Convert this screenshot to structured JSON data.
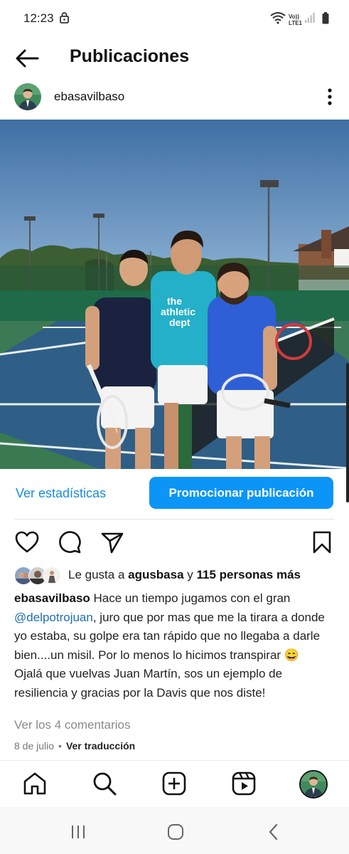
{
  "status_bar": {
    "time": "12:23",
    "icons": [
      "lock-icon",
      "wifi-icon",
      "volte-icon",
      "signal-icon",
      "battery-icon"
    ],
    "network_label_top": "Vo))",
    "network_label_bottom": "LTE1"
  },
  "header": {
    "title": "Publicaciones",
    "back_icon": "arrow-left-icon"
  },
  "post": {
    "username": "ebasavilbaso",
    "more_icon": "more-vertical-icon",
    "photo_description_icon": "photo",
    "stats_link": "Ver estadísticas",
    "promote_button": "Promocionar publicación",
    "actions": [
      "heart-icon",
      "comment-icon",
      "share-icon",
      "bookmark-icon"
    ],
    "likes": {
      "prefix": "Le gusta a ",
      "user": "agusbasa",
      "middle": " y ",
      "others": "115 personas más"
    },
    "caption": {
      "user": "ebasavilbaso",
      "text_before_mention": " Hace un tiempo jugamos con el gran ",
      "mention": "@delpotrojuan",
      "text_after_mention": ", juro que por mas que me la tirara a donde yo estaba, su golpe era tan rápido que no llegaba a darle bien....un misil. Por lo menos lo hicimos transpirar 😄",
      "second_paragraph": "Ojalá que vuelvas Juan Martín, sos un ejemplo de resiliencia y gracias por la Davis que nos diste!"
    },
    "comments_link": "Ver los 4 comentarios",
    "date": "8 de julio",
    "separator": "•",
    "translate_link": "Ver traducción"
  },
  "tab_bar": [
    "home-icon",
    "search-icon",
    "create-icon",
    "reels-icon",
    "profile-avatar"
  ],
  "android_nav": [
    "recents-icon",
    "home-circle-icon",
    "back-chevron-icon"
  ],
  "colors": {
    "accent": "#0b95f6",
    "link": "#1a8cd8",
    "mention": "#1f6fb3"
  }
}
